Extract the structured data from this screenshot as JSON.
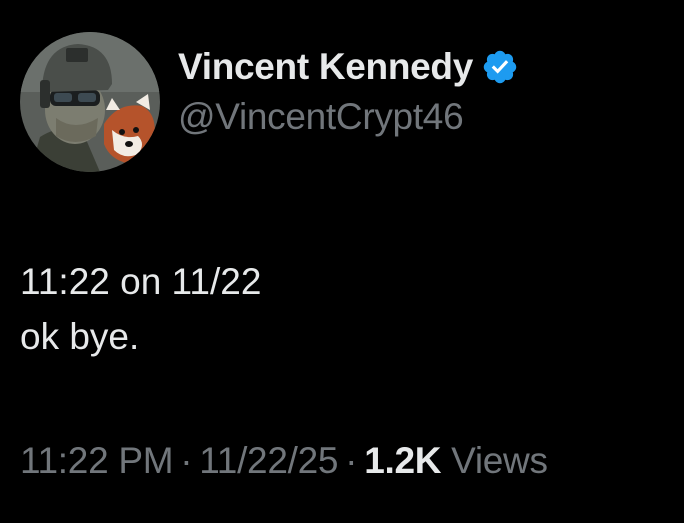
{
  "author": {
    "display_name": "Vincent Kennedy",
    "handle": "@VincentCrypt46",
    "verified": true,
    "avatar_icon": "avatar-soldier-red-panda"
  },
  "post": {
    "lines": [
      "11:22 on 11/22",
      "ok bye."
    ]
  },
  "meta": {
    "time": "11:22 PM",
    "separator": "·",
    "date": "11/22/25",
    "views_count": "1.2K",
    "views_label": "Views"
  },
  "colors": {
    "background": "#000000",
    "primary_text": "#e7e9ea",
    "secondary_text": "#71767b",
    "verified_badge": "#1d9bf0"
  }
}
